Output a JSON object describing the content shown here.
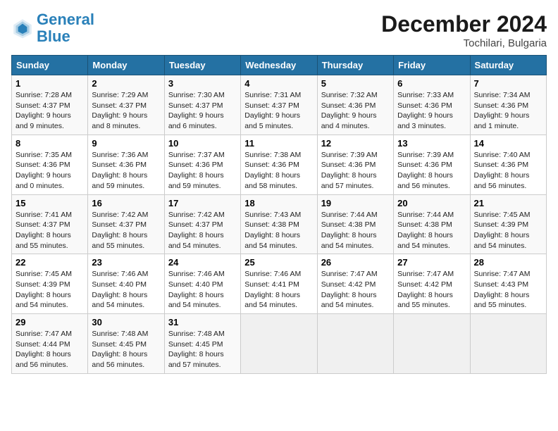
{
  "header": {
    "logo_line1": "General",
    "logo_line2": "Blue",
    "month_title": "December 2024",
    "location": "Tochilari, Bulgaria"
  },
  "weekdays": [
    "Sunday",
    "Monday",
    "Tuesday",
    "Wednesday",
    "Thursday",
    "Friday",
    "Saturday"
  ],
  "weeks": [
    [
      {
        "day": "1",
        "info": "Sunrise: 7:28 AM\nSunset: 4:37 PM\nDaylight: 9 hours and 9 minutes."
      },
      {
        "day": "2",
        "info": "Sunrise: 7:29 AM\nSunset: 4:37 PM\nDaylight: 9 hours and 8 minutes."
      },
      {
        "day": "3",
        "info": "Sunrise: 7:30 AM\nSunset: 4:37 PM\nDaylight: 9 hours and 6 minutes."
      },
      {
        "day": "4",
        "info": "Sunrise: 7:31 AM\nSunset: 4:37 PM\nDaylight: 9 hours and 5 minutes."
      },
      {
        "day": "5",
        "info": "Sunrise: 7:32 AM\nSunset: 4:36 PM\nDaylight: 9 hours and 4 minutes."
      },
      {
        "day": "6",
        "info": "Sunrise: 7:33 AM\nSunset: 4:36 PM\nDaylight: 9 hours and 3 minutes."
      },
      {
        "day": "7",
        "info": "Sunrise: 7:34 AM\nSunset: 4:36 PM\nDaylight: 9 hours and 1 minute."
      }
    ],
    [
      {
        "day": "8",
        "info": "Sunrise: 7:35 AM\nSunset: 4:36 PM\nDaylight: 9 hours and 0 minutes."
      },
      {
        "day": "9",
        "info": "Sunrise: 7:36 AM\nSunset: 4:36 PM\nDaylight: 8 hours and 59 minutes."
      },
      {
        "day": "10",
        "info": "Sunrise: 7:37 AM\nSunset: 4:36 PM\nDaylight: 8 hours and 59 minutes."
      },
      {
        "day": "11",
        "info": "Sunrise: 7:38 AM\nSunset: 4:36 PM\nDaylight: 8 hours and 58 minutes."
      },
      {
        "day": "12",
        "info": "Sunrise: 7:39 AM\nSunset: 4:36 PM\nDaylight: 8 hours and 57 minutes."
      },
      {
        "day": "13",
        "info": "Sunrise: 7:39 AM\nSunset: 4:36 PM\nDaylight: 8 hours and 56 minutes."
      },
      {
        "day": "14",
        "info": "Sunrise: 7:40 AM\nSunset: 4:36 PM\nDaylight: 8 hours and 56 minutes."
      }
    ],
    [
      {
        "day": "15",
        "info": "Sunrise: 7:41 AM\nSunset: 4:37 PM\nDaylight: 8 hours and 55 minutes."
      },
      {
        "day": "16",
        "info": "Sunrise: 7:42 AM\nSunset: 4:37 PM\nDaylight: 8 hours and 55 minutes."
      },
      {
        "day": "17",
        "info": "Sunrise: 7:42 AM\nSunset: 4:37 PM\nDaylight: 8 hours and 54 minutes."
      },
      {
        "day": "18",
        "info": "Sunrise: 7:43 AM\nSunset: 4:38 PM\nDaylight: 8 hours and 54 minutes."
      },
      {
        "day": "19",
        "info": "Sunrise: 7:44 AM\nSunset: 4:38 PM\nDaylight: 8 hours and 54 minutes."
      },
      {
        "day": "20",
        "info": "Sunrise: 7:44 AM\nSunset: 4:38 PM\nDaylight: 8 hours and 54 minutes."
      },
      {
        "day": "21",
        "info": "Sunrise: 7:45 AM\nSunset: 4:39 PM\nDaylight: 8 hours and 54 minutes."
      }
    ],
    [
      {
        "day": "22",
        "info": "Sunrise: 7:45 AM\nSunset: 4:39 PM\nDaylight: 8 hours and 54 minutes."
      },
      {
        "day": "23",
        "info": "Sunrise: 7:46 AM\nSunset: 4:40 PM\nDaylight: 8 hours and 54 minutes."
      },
      {
        "day": "24",
        "info": "Sunrise: 7:46 AM\nSunset: 4:40 PM\nDaylight: 8 hours and 54 minutes."
      },
      {
        "day": "25",
        "info": "Sunrise: 7:46 AM\nSunset: 4:41 PM\nDaylight: 8 hours and 54 minutes."
      },
      {
        "day": "26",
        "info": "Sunrise: 7:47 AM\nSunset: 4:42 PM\nDaylight: 8 hours and 54 minutes."
      },
      {
        "day": "27",
        "info": "Sunrise: 7:47 AM\nSunset: 4:42 PM\nDaylight: 8 hours and 55 minutes."
      },
      {
        "day": "28",
        "info": "Sunrise: 7:47 AM\nSunset: 4:43 PM\nDaylight: 8 hours and 55 minutes."
      }
    ],
    [
      {
        "day": "29",
        "info": "Sunrise: 7:47 AM\nSunset: 4:44 PM\nDaylight: 8 hours and 56 minutes."
      },
      {
        "day": "30",
        "info": "Sunrise: 7:48 AM\nSunset: 4:45 PM\nDaylight: 8 hours and 56 minutes."
      },
      {
        "day": "31",
        "info": "Sunrise: 7:48 AM\nSunset: 4:45 PM\nDaylight: 8 hours and 57 minutes."
      },
      null,
      null,
      null,
      null
    ]
  ]
}
